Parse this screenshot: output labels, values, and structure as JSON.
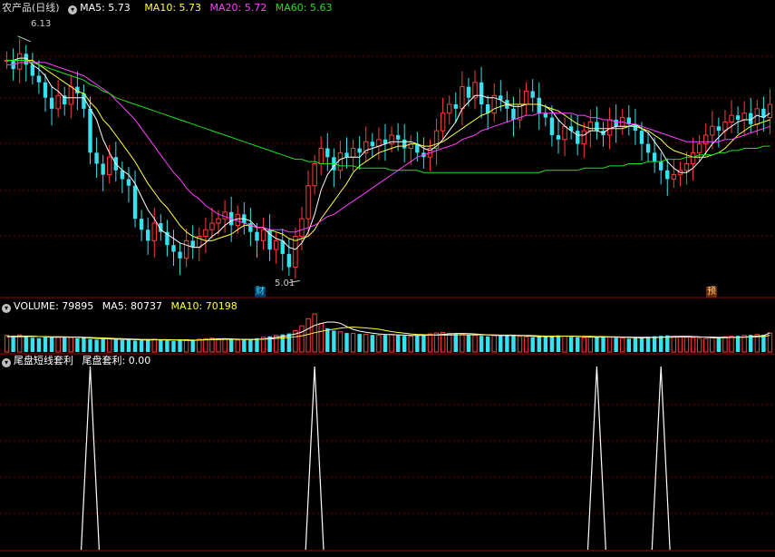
{
  "panel_main": {
    "name": "农产品(日线)",
    "ma5_label": "MA5: 5.73",
    "ma10_label": "MA10: 5.73",
    "ma20_label": "MA20: 5.72",
    "ma60_label": "MA60: 5.63",
    "high_label": "6.13",
    "low_label": "5.01",
    "event_tag_1": "财",
    "event_tag_2": "预"
  },
  "panel_volume": {
    "volume_label": "VOLUME: 79895",
    "ma5_label": "MA5: 80737",
    "ma10_label": "MA10: 70198"
  },
  "panel_signal": {
    "name": "尾盘短线套利",
    "value_label": "尾盘套利: 0.00"
  },
  "colors": {
    "up": "#ff3b3b",
    "down": "#36e1f0",
    "ma5": "#ffffff",
    "ma10": "#ffff40",
    "ma20": "#ff40ff",
    "ma60": "#20e020",
    "grid": "#7a0000",
    "border": "#a00000"
  },
  "chart_data": [
    {
      "type": "candlestick",
      "title": "农产品(日线)",
      "ylim": [
        4.95,
        6.22
      ],
      "annotations": [
        "6.13",
        "5.01"
      ],
      "legend": [
        "MA5: 5.73",
        "MA10: 5.73",
        "MA20: 5.72",
        "MA60: 5.63"
      ],
      "close": [
        6.02,
        5.98,
        6.05,
        6.0,
        5.95,
        5.92,
        5.85,
        5.8,
        5.86,
        5.82,
        5.9,
        5.87,
        5.8,
        5.6,
        5.55,
        5.5,
        5.58,
        5.52,
        5.48,
        5.45,
        5.3,
        5.25,
        5.2,
        5.28,
        5.24,
        5.18,
        5.15,
        5.12,
        5.2,
        5.17,
        5.22,
        5.25,
        5.28,
        5.3,
        5.33,
        5.27,
        5.32,
        5.28,
        5.24,
        5.2,
        5.25,
        5.16,
        5.2,
        5.14,
        5.08,
        5.22,
        5.3,
        5.45,
        5.55,
        5.62,
        5.58,
        5.52,
        5.6,
        5.58,
        5.62,
        5.6,
        5.65,
        5.63,
        5.66,
        5.64,
        5.68,
        5.66,
        5.62,
        5.64,
        5.6,
        5.58,
        5.62,
        5.7,
        5.78,
        5.82,
        5.8,
        5.9,
        5.85,
        5.92,
        5.82,
        5.78,
        5.86,
        5.84,
        5.8,
        5.75,
        5.82,
        5.88,
        5.85,
        5.78,
        5.76,
        5.68,
        5.66,
        5.72,
        5.7,
        5.64,
        5.7,
        5.74,
        5.7,
        5.68,
        5.75,
        5.72,
        5.76,
        5.73,
        5.7,
        5.64,
        5.6,
        5.56,
        5.52,
        5.48,
        5.5,
        5.52,
        5.55,
        5.6,
        5.64,
        5.68,
        5.72,
        5.7,
        5.74,
        5.77,
        5.75,
        5.78,
        5.73,
        5.8,
        5.76,
        5.82
      ],
      "ma_series": [
        {
          "name": "MA5",
          "values": [
            6.02,
            6.02,
            6.03,
            6.03,
            6.0,
            5.98,
            5.95,
            5.9,
            5.88,
            5.85,
            5.85,
            5.85,
            5.85,
            5.8,
            5.75,
            5.66,
            5.6,
            5.55,
            5.52,
            5.5,
            5.46,
            5.4,
            5.34,
            5.3,
            5.25,
            5.23,
            5.21,
            5.19,
            5.18,
            5.17,
            5.17,
            5.19,
            5.22,
            5.24,
            5.27,
            5.29,
            5.3,
            5.3,
            5.29,
            5.26,
            5.26,
            5.23,
            5.21,
            5.2,
            5.17,
            5.16,
            5.19,
            5.24,
            5.32,
            5.43,
            5.5,
            5.54,
            5.57,
            5.58,
            5.58,
            5.58,
            5.61,
            5.62,
            5.63,
            5.64,
            5.65,
            5.65,
            5.65,
            5.65,
            5.64,
            5.62,
            5.61,
            5.63,
            5.66,
            5.7,
            5.74,
            5.8,
            5.83,
            5.86,
            5.86,
            5.85,
            5.85,
            5.84,
            5.82,
            5.81,
            5.81,
            5.82,
            5.82,
            5.82,
            5.81,
            5.79,
            5.75,
            5.72,
            5.7,
            5.68,
            5.68,
            5.7,
            5.7,
            5.69,
            5.71,
            5.72,
            5.72,
            5.72,
            5.73,
            5.71,
            5.69,
            5.65,
            5.61,
            5.56,
            5.53,
            5.51,
            5.51,
            5.53,
            5.56,
            5.6,
            5.64,
            5.67,
            5.7,
            5.72,
            5.74,
            5.75,
            5.75,
            5.77,
            5.76,
            5.78
          ]
        },
        {
          "name": "MA10",
          "values": [
            6.02,
            6.02,
            6.02,
            6.02,
            6.02,
            6.0,
            5.98,
            5.96,
            5.94,
            5.92,
            5.9,
            5.88,
            5.87,
            5.83,
            5.8,
            5.75,
            5.72,
            5.68,
            5.64,
            5.6,
            5.56,
            5.51,
            5.46,
            5.42,
            5.38,
            5.35,
            5.31,
            5.27,
            5.24,
            5.22,
            5.21,
            5.2,
            5.2,
            5.21,
            5.22,
            5.23,
            5.25,
            5.27,
            5.27,
            5.26,
            5.26,
            5.25,
            5.24,
            5.23,
            5.21,
            5.2,
            5.21,
            5.22,
            5.25,
            5.3,
            5.34,
            5.38,
            5.42,
            5.46,
            5.51,
            5.54,
            5.56,
            5.58,
            5.6,
            5.61,
            5.62,
            5.63,
            5.63,
            5.64,
            5.64,
            5.63,
            5.63,
            5.64,
            5.65,
            5.67,
            5.69,
            5.71,
            5.73,
            5.75,
            5.77,
            5.78,
            5.8,
            5.81,
            5.82,
            5.82,
            5.82,
            5.82,
            5.82,
            5.82,
            5.81,
            5.8,
            5.79,
            5.77,
            5.75,
            5.73,
            5.72,
            5.71,
            5.71,
            5.71,
            5.71,
            5.71,
            5.71,
            5.72,
            5.72,
            5.71,
            5.7,
            5.68,
            5.66,
            5.63,
            5.61,
            5.6,
            5.59,
            5.58,
            5.58,
            5.58,
            5.59,
            5.6,
            5.62,
            5.65,
            5.68,
            5.7,
            5.72,
            5.73,
            5.74,
            5.75
          ]
        },
        {
          "name": "MA20",
          "values": [
            6.0,
            6.0,
            6.01,
            6.01,
            6.01,
            6.01,
            6.01,
            6.0,
            5.99,
            5.98,
            5.97,
            5.96,
            5.95,
            5.93,
            5.91,
            5.89,
            5.87,
            5.84,
            5.81,
            5.78,
            5.75,
            5.71,
            5.67,
            5.63,
            5.59,
            5.55,
            5.51,
            5.48,
            5.44,
            5.41,
            5.39,
            5.36,
            5.34,
            5.32,
            5.31,
            5.3,
            5.29,
            5.28,
            5.27,
            5.26,
            5.26,
            5.25,
            5.25,
            5.25,
            5.24,
            5.24,
            5.25,
            5.26,
            5.27,
            5.29,
            5.31,
            5.32,
            5.34,
            5.36,
            5.38,
            5.4,
            5.42,
            5.44,
            5.46,
            5.48,
            5.5,
            5.52,
            5.54,
            5.56,
            5.58,
            5.59,
            5.6,
            5.61,
            5.62,
            5.63,
            5.64,
            5.66,
            5.67,
            5.68,
            5.7,
            5.71,
            5.72,
            5.73,
            5.74,
            5.75,
            5.76,
            5.77,
            5.77,
            5.78,
            5.78,
            5.78,
            5.78,
            5.78,
            5.78,
            5.77,
            5.77,
            5.76,
            5.76,
            5.75,
            5.75,
            5.74,
            5.74,
            5.73,
            5.73,
            5.72,
            5.71,
            5.7,
            5.69,
            5.68,
            5.67,
            5.66,
            5.65,
            5.65,
            5.65,
            5.65,
            5.65,
            5.65,
            5.66,
            5.66,
            5.67,
            5.68,
            5.69,
            5.7,
            5.71,
            5.72
          ]
        },
        {
          "name": "MA60",
          "values": [
            6.02,
            6.02,
            6.02,
            6.02,
            6.01,
            6.0,
            5.99,
            5.98,
            5.97,
            5.96,
            5.95,
            5.94,
            5.93,
            5.91,
            5.9,
            5.88,
            5.87,
            5.85,
            5.84,
            5.83,
            5.82,
            5.81,
            5.8,
            5.79,
            5.78,
            5.77,
            5.76,
            5.75,
            5.74,
            5.73,
            5.72,
            5.71,
            5.7,
            5.69,
            5.68,
            5.67,
            5.66,
            5.65,
            5.64,
            5.63,
            5.62,
            5.61,
            5.6,
            5.59,
            5.58,
            5.57,
            5.57,
            5.56,
            5.56,
            5.55,
            5.55,
            5.55,
            5.54,
            5.54,
            5.54,
            5.53,
            5.53,
            5.53,
            5.53,
            5.53,
            5.52,
            5.52,
            5.52,
            5.52,
            5.52,
            5.51,
            5.51,
            5.51,
            5.51,
            5.51,
            5.51,
            5.51,
            5.51,
            5.51,
            5.51,
            5.51,
            5.51,
            5.51,
            5.51,
            5.51,
            5.51,
            5.51,
            5.51,
            5.51,
            5.52,
            5.52,
            5.52,
            5.52,
            5.52,
            5.52,
            5.53,
            5.53,
            5.53,
            5.53,
            5.54,
            5.54,
            5.54,
            5.55,
            5.55,
            5.55,
            5.56,
            5.56,
            5.56,
            5.57,
            5.57,
            5.57,
            5.58,
            5.58,
            5.59,
            5.59,
            5.59,
            5.6,
            5.6,
            5.61,
            5.61,
            5.62,
            5.62,
            5.62,
            5.63,
            5.63
          ]
        }
      ]
    },
    {
      "type": "bar",
      "title": "VOLUME",
      "legend": [
        "VOLUME: 79895",
        "MA5: 80737",
        "MA10: 70198"
      ],
      "values": [
        70,
        68,
        72,
        66,
        60,
        58,
        62,
        66,
        64,
        60,
        62,
        58,
        60,
        55,
        52,
        54,
        56,
        52,
        50,
        52,
        48,
        50,
        52,
        54,
        50,
        48,
        46,
        50,
        52,
        50,
        54,
        56,
        58,
        56,
        54,
        52,
        50,
        52,
        54,
        58,
        62,
        66,
        70,
        74,
        78,
        90,
        110,
        140,
        160,
        120,
        100,
        90,
        85,
        80,
        78,
        76,
        74,
        72,
        70,
        72,
        74,
        70,
        68,
        66,
        70,
        72,
        76,
        80,
        82,
        78,
        76,
        74,
        72,
        70,
        68,
        66,
        70,
        72,
        70,
        68,
        66,
        64,
        62,
        64,
        66,
        68,
        70,
        66,
        64,
        62,
        60,
        62,
        64,
        66,
        62,
        60,
        58,
        56,
        60,
        62,
        64,
        66,
        68,
        70,
        66,
        64,
        62,
        60,
        58,
        56,
        60,
        62,
        64,
        66,
        68,
        70,
        72,
        74,
        72,
        79.9
      ],
      "ma5": [
        66,
        66,
        67,
        67,
        67,
        65,
        64,
        62,
        62,
        62,
        62,
        62,
        60,
        59,
        57,
        56,
        55,
        54,
        53,
        53,
        52,
        51,
        50,
        51,
        51,
        50,
        50,
        50,
        49,
        49,
        50,
        52,
        54,
        55,
        56,
        55,
        54,
        53,
        52,
        53,
        55,
        58,
        62,
        66,
        70,
        76,
        84,
        98,
        112,
        120,
        126,
        126,
        121,
        107,
        95,
        88,
        83,
        79,
        76,
        74,
        73,
        72,
        71,
        70,
        70,
        70,
        71,
        72,
        74,
        76,
        78,
        78,
        77,
        76,
        74,
        72,
        70,
        69,
        69,
        69,
        69,
        68,
        66,
        65,
        65,
        65,
        66,
        67,
        67,
        66,
        64,
        63,
        62,
        63,
        63,
        62,
        62,
        61,
        60,
        59,
        60,
        61,
        62,
        64,
        65,
        66,
        66,
        65,
        64,
        62,
        60,
        59,
        60,
        61,
        62,
        63,
        65,
        67,
        69,
        80.7
      ],
      "ma10": [
        64,
        64,
        64,
        65,
        65,
        65,
        65,
        64,
        64,
        64,
        63,
        63,
        62,
        61,
        60,
        59,
        58,
        57,
        56,
        55,
        54,
        53,
        53,
        52,
        52,
        52,
        51,
        51,
        51,
        50,
        50,
        51,
        52,
        52,
        53,
        53,
        53,
        53,
        53,
        53,
        54,
        55,
        57,
        59,
        61,
        64,
        68,
        74,
        81,
        87,
        92,
        96,
        100,
        103,
        105,
        103,
        101,
        99,
        96,
        91,
        86,
        82,
        79,
        76,
        74,
        73,
        72,
        71,
        71,
        71,
        72,
        72,
        72,
        72,
        72,
        72,
        72,
        71,
        71,
        71,
        70,
        70,
        69,
        68,
        67,
        67,
        67,
        67,
        66,
        66,
        66,
        66,
        65,
        65,
        64,
        64,
        63,
        63,
        62,
        62,
        62,
        62,
        62,
        62,
        62,
        63,
        63,
        63,
        63,
        63,
        63,
        62,
        62,
        62,
        62,
        62,
        63,
        64,
        65,
        70.2
      ]
    },
    {
      "type": "line",
      "title": "尾盘短线套利",
      "legend": [
        "尾盘套利: 0.00"
      ],
      "signal_indices": [
        13,
        48,
        92,
        102
      ],
      "ylim": [
        0,
        1
      ],
      "signal_peak": 1
    }
  ]
}
